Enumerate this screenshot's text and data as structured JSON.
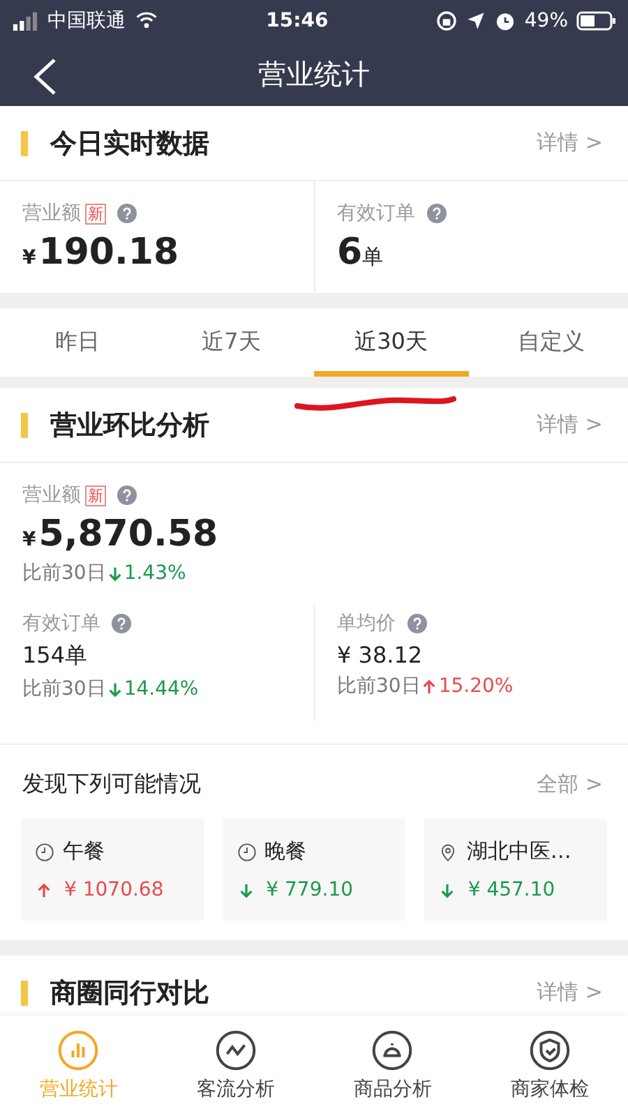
{
  "status_bar": {
    "carrier": "中国联通",
    "time": "15:46",
    "battery": "49%"
  },
  "nav": {
    "title": "营业统计"
  },
  "today": {
    "title": "今日实时数据",
    "link": "详情 >",
    "metrics": [
      {
        "label": "营业额",
        "badge": "新",
        "currency": "¥",
        "value": "190.18"
      },
      {
        "label": "有效订单",
        "value": "6",
        "unit": "单"
      }
    ]
  },
  "tabs": [
    {
      "label": "昨日",
      "selected": false
    },
    {
      "label": "近7天",
      "selected": false
    },
    {
      "label": "近30天",
      "selected": true
    },
    {
      "label": "自定义",
      "selected": false
    }
  ],
  "analysis": {
    "title": "营业环比分析",
    "link": "详情 >",
    "main": {
      "label": "营业额",
      "badge": "新",
      "currency": "¥",
      "value": "5,870.58",
      "compare": "比前30日",
      "increase": false,
      "change": "1.43%"
    },
    "metrics": [
      {
        "label": "有效订单",
        "value": "154单",
        "compare": "比前30日",
        "increase": false,
        "change": "14.44%"
      },
      {
        "label": "单均价",
        "value": "¥ 38.12",
        "compare": "比前30日",
        "increase": true,
        "change": "15.20%"
      }
    ]
  },
  "findings": {
    "title": "发现下列可能情况",
    "link": "全部 >",
    "cards": [
      {
        "kind": "time",
        "label": "午餐",
        "increase": true,
        "amount": "¥ 1070.68"
      },
      {
        "kind": "time",
        "label": "晚餐",
        "increase": false,
        "amount": "¥ 779.10"
      },
      {
        "kind": "place",
        "label": "湖北中医…",
        "increase": false,
        "amount": "¥ 457.10"
      }
    ]
  },
  "next_section": {
    "title": "商圈同行对比",
    "link": "详情 >"
  },
  "bottom_tabs": [
    {
      "kind": "chart",
      "label": "营业统计",
      "selected": true
    },
    {
      "kind": "trend",
      "label": "客流分析",
      "selected": false
    },
    {
      "kind": "dish",
      "label": "商品分析",
      "selected": false
    },
    {
      "kind": "shield",
      "label": "商家体检",
      "selected": false
    }
  ]
}
